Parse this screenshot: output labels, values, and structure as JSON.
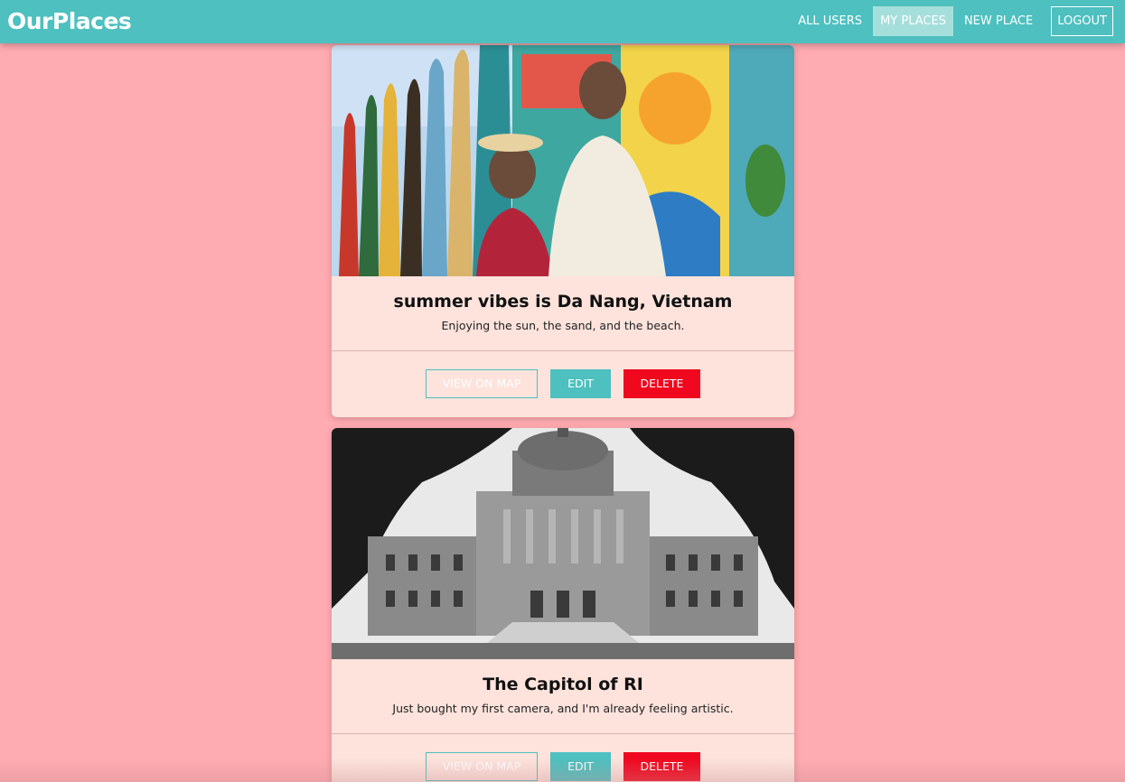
{
  "header": {
    "logo": "OurPlaces",
    "nav": {
      "all_users": "ALL USERS",
      "my_places": "MY PLACES",
      "new_place": "NEW PLACE",
      "logout": "LOGOUT"
    },
    "colors": {
      "bar": "#4dc0bf",
      "active": "#a5dfdb"
    }
  },
  "places": [
    {
      "title": "summer vibes is Da Nang, Vietnam",
      "description": "Enjoying the sun, the sand, and the beach.",
      "view_label": "VIEW ON MAP",
      "edit_label": "EDIT",
      "delete_label": "DELETE"
    },
    {
      "title": "The Capitol of RI",
      "description": "Just bought my first camera, and I'm already feeling artistic.",
      "view_label": "VIEW ON MAP",
      "edit_label": "EDIT",
      "delete_label": "DELETE"
    }
  ],
  "colors": {
    "background": "#ffabb1",
    "card": "#fde3dc",
    "delete": "#f0081f"
  }
}
